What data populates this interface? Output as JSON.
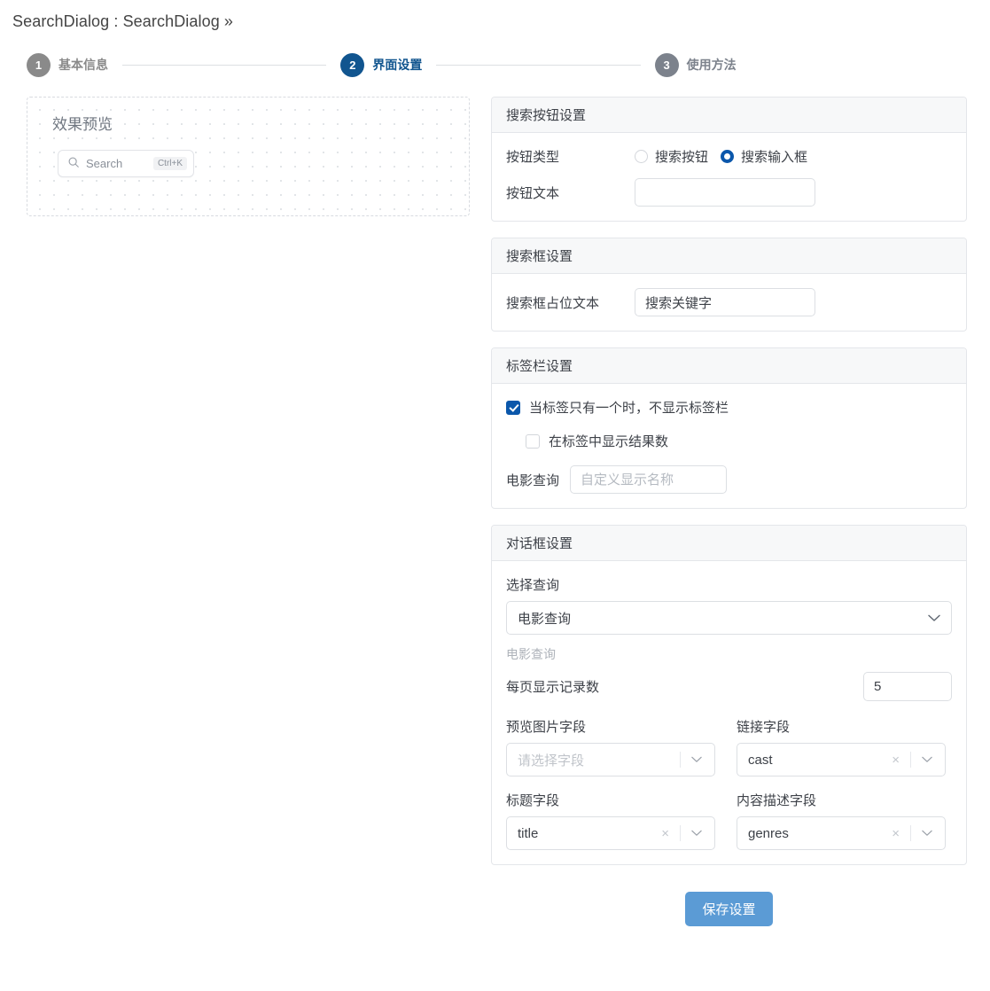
{
  "breadcrumb": {
    "text": "SearchDialog : SearchDialog »"
  },
  "stepper": {
    "steps": [
      {
        "num": "1",
        "label": "基本信息",
        "state": "done"
      },
      {
        "num": "2",
        "label": "界面设置",
        "state": "active"
      },
      {
        "num": "3",
        "label": "使用方法",
        "state": "pending"
      }
    ]
  },
  "preview": {
    "title": "效果预览",
    "search_placeholder": "Search",
    "shortcut": "Ctrl+K"
  },
  "cards": {
    "search_button": {
      "header": "搜索按钮设置",
      "type_label": "按钮类型",
      "options": [
        {
          "label": "搜索按钮",
          "checked": false
        },
        {
          "label": "搜索输入框",
          "checked": true
        }
      ],
      "text_label": "按钮文本",
      "text_value": "",
      "text_placeholder": ""
    },
    "search_box": {
      "header": "搜索框设置",
      "placeholder_label": "搜索框占位文本",
      "placeholder_value": "搜索关键字"
    },
    "tab_bar": {
      "header": "标签栏设置",
      "check_hide_single": {
        "label": "当标签只有一个时，不显示标签栏",
        "checked": true
      },
      "check_show_count": {
        "label": "在标签中显示结果数",
        "checked": false
      },
      "tab_name_label": "电影查询",
      "tab_name_value": "",
      "tab_name_placeholder": "自定义显示名称"
    },
    "dialog": {
      "header": "对话框设置",
      "select_query_label": "选择查询",
      "select_query_value": "电影查询",
      "query_hint": "电影查询",
      "per_page_label": "每页显示记录数",
      "per_page_value": "5",
      "fields": [
        {
          "label": "预览图片字段",
          "value": "",
          "placeholder": "请选择字段",
          "clearable": false
        },
        {
          "label": "链接字段",
          "value": "cast",
          "placeholder": "",
          "clearable": true
        },
        {
          "label": "标题字段",
          "value": "title",
          "placeholder": "",
          "clearable": true
        },
        {
          "label": "内容描述字段",
          "value": "genres",
          "placeholder": "",
          "clearable": true
        }
      ]
    }
  },
  "footer": {
    "save_label": "保存设置"
  },
  "colors": {
    "accent_blue": "#0b57ab",
    "step_active": "#11558f",
    "step_muted": "#7c828c",
    "save_button": "#5b9bd5"
  }
}
